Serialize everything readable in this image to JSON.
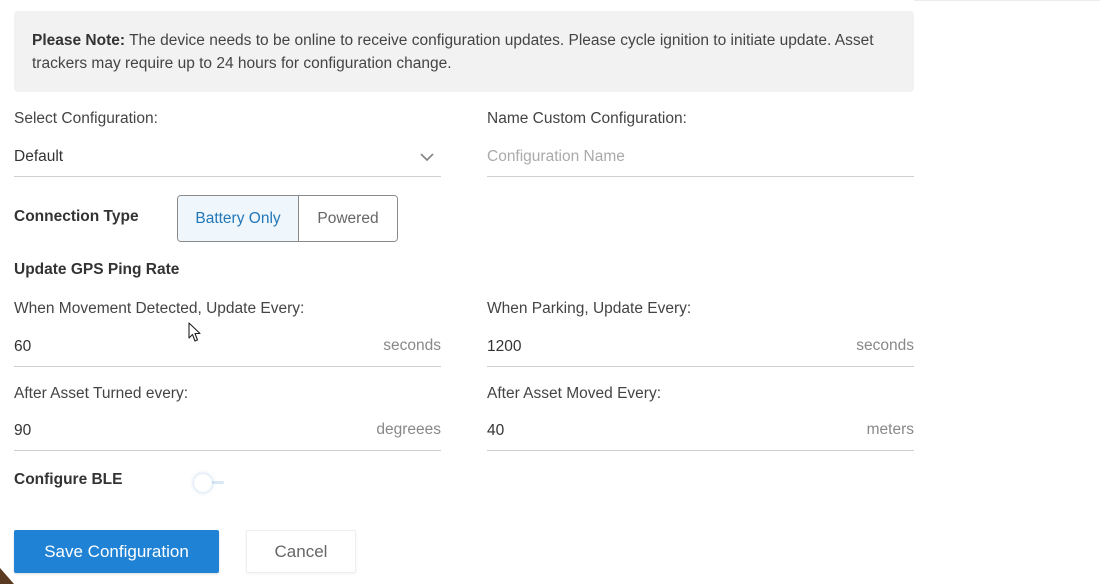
{
  "note": {
    "prefix": "Please Note:",
    "text": " The device needs to be online to receive configuration updates. Please cycle ignition to initiate update. Asset trackers may require up to 24 hours for configuration change."
  },
  "select_configuration": {
    "label": "Select Configuration:",
    "value": "Default"
  },
  "custom_configuration": {
    "label": "Name Custom Configuration:",
    "placeholder": "Configuration Name"
  },
  "connection_type": {
    "label": "Connection Type",
    "options": [
      "Battery Only",
      "Powered"
    ],
    "selected": "Battery Only"
  },
  "gps": {
    "heading": "Update GPS Ping Rate",
    "movement": {
      "label": "When Movement Detected, Update Every:",
      "value": "60",
      "unit": "seconds"
    },
    "parking": {
      "label": "When Parking, Update Every:",
      "value": "1200",
      "unit": "seconds"
    },
    "turned": {
      "label": "After Asset Turned every:",
      "value": "90",
      "unit": "degreees"
    },
    "moved": {
      "label": "After Asset Moved Every:",
      "value": "40",
      "unit": "meters"
    }
  },
  "ble": {
    "label": "Configure BLE",
    "enabled": false
  },
  "actions": {
    "save_label": "Save Configuration",
    "cancel_label": "Cancel"
  },
  "colors": {
    "primary": "#1f82d4",
    "active_text": "#2277b8",
    "note_bg": "#f2f2f2"
  }
}
